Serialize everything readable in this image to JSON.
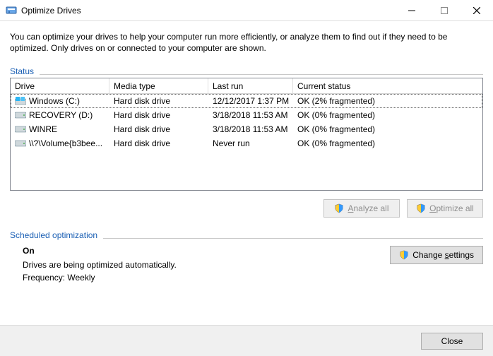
{
  "titlebar": {
    "title": "Optimize Drives"
  },
  "intro": "You can optimize your drives to help your computer run more efficiently, or analyze them to find out if they need to be optimized. Only drives on or connected to your computer are shown.",
  "status_label": "Status",
  "columns": {
    "drive": "Drive",
    "media": "Media type",
    "last": "Last run",
    "status": "Current status"
  },
  "drives": [
    {
      "name": "Windows (C:)",
      "media": "Hard disk drive",
      "last": "12/12/2017 1:37 PM",
      "status": "OK (2% fragmented)",
      "icon": "os",
      "selected": true
    },
    {
      "name": "RECOVERY (D:)",
      "media": "Hard disk drive",
      "last": "3/18/2018 11:53 AM",
      "status": "OK (0% fragmented)",
      "icon": "hdd",
      "selected": false
    },
    {
      "name": "WINRE",
      "media": "Hard disk drive",
      "last": "3/18/2018 11:53 AM",
      "status": "OK (0% fragmented)",
      "icon": "hdd",
      "selected": false
    },
    {
      "name": "\\\\?\\Volume{b3bee...",
      "media": "Hard disk drive",
      "last": "Never run",
      "status": "OK (0% fragmented)",
      "icon": "hdd",
      "selected": false
    }
  ],
  "buttons": {
    "analyze_pre": "",
    "analyze_ul": "A",
    "analyze_post": "nalyze all",
    "optimize_pre": "",
    "optimize_ul": "O",
    "optimize_post": "ptimize all",
    "change_pre": "Change ",
    "change_ul": "s",
    "change_post": "ettings",
    "close_pre": "",
    "close_ul": "C",
    "close_post": "lose"
  },
  "scheduled": {
    "label": "Scheduled optimization",
    "on": "On",
    "desc": "Drives are being optimized automatically.",
    "freq": "Frequency: Weekly"
  }
}
